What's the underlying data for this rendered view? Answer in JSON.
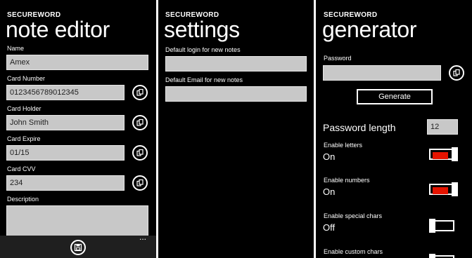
{
  "app_name": "SECUREWORD",
  "note_editor": {
    "title": "note editor",
    "fields": [
      {
        "label": "Name",
        "value": "Amex"
      },
      {
        "label": "Card Number",
        "value": "0123456789012345"
      },
      {
        "label": "Card Holder",
        "value": "John Smith"
      },
      {
        "label": "Card Expire",
        "value": "01/15"
      },
      {
        "label": "Card CVV",
        "value": "234"
      },
      {
        "label": "Description",
        "value": ""
      }
    ],
    "copy_icon": "copy-icon",
    "appbar": {
      "save_icon": "save-icon",
      "more": "..."
    }
  },
  "settings": {
    "title": "settings",
    "default_login_label": "Default login for new notes",
    "default_login_value": "",
    "default_email_label": "Default Email for new notes",
    "default_email_value": ""
  },
  "generator": {
    "title": "generator",
    "password_label": "Password",
    "password_value": "",
    "generate_label": "Generate",
    "length_label": "Password length",
    "length_value": "12",
    "toggles": [
      {
        "label": "Enable letters",
        "state": "On",
        "on": true
      },
      {
        "label": "Enable numbers",
        "state": "On",
        "on": true
      },
      {
        "label": "Enable special chars",
        "state": "Off",
        "on": false
      },
      {
        "label": "Enable custom chars",
        "state": "",
        "on": false
      }
    ]
  },
  "colors": {
    "accent": "#e51400",
    "background": "#000000",
    "textbox": "#c8c8c8"
  }
}
